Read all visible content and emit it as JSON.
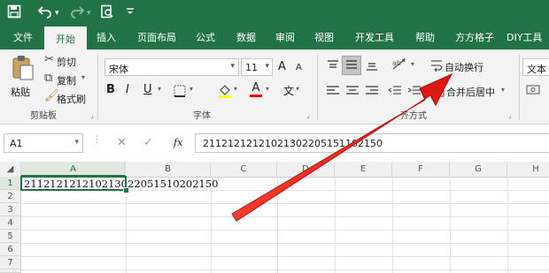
{
  "title_bar": {
    "icons": [
      "save-icon",
      "undo-icon",
      "undo-dropdown-icon",
      "redo-icon",
      "redo-dropdown-icon",
      "print-preview-icon",
      "customize-qat-icon"
    ]
  },
  "tabs": [
    "文件",
    "开始",
    "插入",
    "页面布局",
    "公式",
    "数据",
    "审阅",
    "视图",
    "开发工具",
    "帮助",
    "方方格子",
    "DIY工具"
  ],
  "active_tab": "开始",
  "ribbon": {
    "clipboard": {
      "paste_label": "粘贴",
      "cut_label": "剪切",
      "copy_label": "复制",
      "format_painter_label": "格式刷",
      "group_label": "剪贴板"
    },
    "font": {
      "font_name": "宋体",
      "font_size": "11",
      "grow_label": "A",
      "shrink_label": "A",
      "bold_label": "B",
      "italic_label": "I",
      "underline_label": "U",
      "font_color_label": "A",
      "pinyin_label": "文",
      "group_label": "字体",
      "fill_color": "#ffff00",
      "font_color": "#ff0000"
    },
    "alignment": {
      "wrap_text_label": "自动换行",
      "merge_center_label": "合并后居中",
      "group_label": "对齐方式",
      "group_label_visible": "齐方式"
    },
    "number": {
      "format_label": "文本"
    }
  },
  "formula_bar": {
    "name_box": "A1",
    "fx_label": "fx",
    "formula_value": "21121212121021302205151102150"
  },
  "columns": [
    "A",
    "B",
    "C",
    "D",
    "E",
    "F",
    "G",
    "H"
  ],
  "rows": [
    "1",
    "2",
    "3",
    "4",
    "5",
    "6",
    "7",
    "8"
  ],
  "cells": {
    "A1": "211212121210213022051510202150"
  },
  "colors": {
    "brand_green": "#217346",
    "arrow_red": "#e8261f"
  }
}
